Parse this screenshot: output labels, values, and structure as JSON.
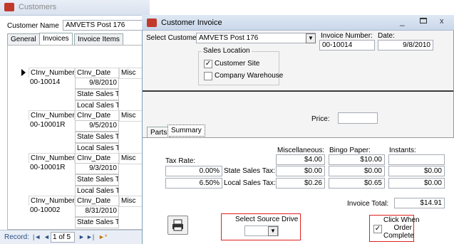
{
  "back_window": {
    "title": "Customers",
    "customer_name_label": "Customer Name",
    "customer_name_value": "AMVETS Post 176",
    "tabs": [
      "General",
      "Invoices",
      "Invoice Items"
    ],
    "grid_header_misc": "Misc",
    "rows": [
      {
        "num_label": "CInv_Number",
        "date_label": "CInv_Date",
        "num": "00-10014",
        "date": "9/8/2010"
      },
      {
        "num_label": "CInv_Number",
        "date_label": "CInv_Date",
        "num": "00-10001R",
        "date": "9/5/2010"
      },
      {
        "num_label": "CInv_Number",
        "date_label": "CInv_Date",
        "num": "00-10001R",
        "date": "9/3/2010"
      },
      {
        "num_label": "CInv_Number",
        "date_label": "CInv_Date",
        "num": "00-10002",
        "date": "8/31/2010"
      }
    ],
    "state_tax_label": "State Sales Tax",
    "local_tax_label": "Local Sales Tax",
    "record_nav": {
      "label": "Record:",
      "current": "1",
      "of_text": "of 5"
    }
  },
  "front_window": {
    "title": "Customer Invoice",
    "select_customer_label": "Select Customer:",
    "select_customer_value": "AMVETS Post 176",
    "invoice_number_label": "Invoice Number:",
    "invoice_number_value": "00-10014",
    "date_label": "Date:",
    "date_value": "9/8/2010",
    "sales_location_label": "Sales Location",
    "customer_site_label": "Customer Site",
    "customer_site_checked": true,
    "company_warehouse_label": "Company Warehouse",
    "company_warehouse_checked": false,
    "price_label": "Price:",
    "tabs": [
      "Parts",
      "Summary"
    ],
    "active_tab": "Summary",
    "summary": {
      "col_misc": "Miscellaneous:",
      "col_bingo": "Bingo Paper:",
      "col_instants": "Instants:",
      "tax_rate_label": "Tax Rate:",
      "row_totals": {
        "misc": "$4.00",
        "bingo": "$10.00",
        "instants": ""
      },
      "state_rate": "0.00%",
      "state_label": "State Sales Tax:",
      "state_values": {
        "misc": "$0.00",
        "bingo": "$0.00",
        "instants": "$0.00"
      },
      "local_rate": "6.50%",
      "local_label": "Local Sales Tax:",
      "local_values": {
        "misc": "$0.26",
        "bingo": "$0.65",
        "instants": "$0.00"
      },
      "invoice_total_label": "Invoice Total:",
      "invoice_total_value": "$14.91"
    },
    "select_source_drive_label": "Select Source Drive",
    "click_when_complete_label": [
      "Click When",
      "Order",
      "Complete"
    ],
    "click_when_complete_checked": true
  }
}
